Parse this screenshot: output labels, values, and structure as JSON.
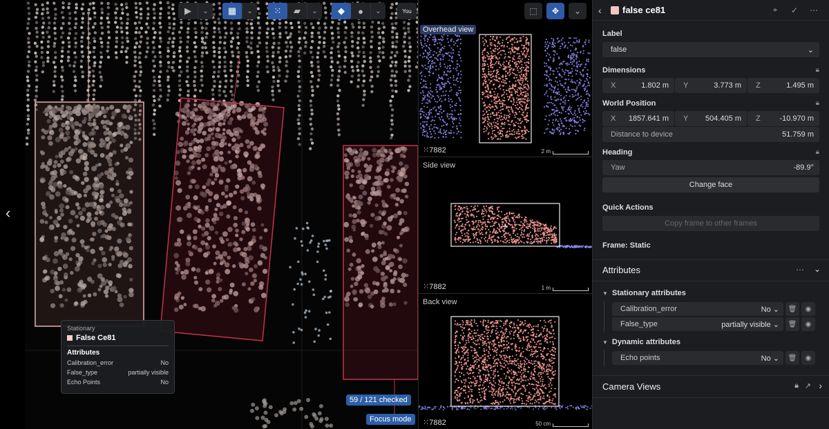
{
  "toolbar": {
    "icons": [
      "camera-icon",
      "grid-icon",
      "points-icon",
      "label-icon",
      "layers-icon",
      "sphere-icon"
    ],
    "you_badge": "You"
  },
  "hover_card": {
    "category": "Stationary",
    "name": "False Ce81",
    "attributes_heading": "Attributes",
    "rows": [
      {
        "k": "Calibration_error",
        "v": "No"
      },
      {
        "k": "False_type",
        "v": "partially visible"
      },
      {
        "k": "Echo Points",
        "v": "No"
      }
    ]
  },
  "status": {
    "checked": "59 / 121 checked",
    "focus_mode": "Focus mode"
  },
  "views": {
    "overhead": {
      "title": "Overhead view",
      "id": "7882",
      "scale": "2 m"
    },
    "side": {
      "title": "Side view",
      "id": "7882",
      "scale": "1 m"
    },
    "back": {
      "title": "Back view",
      "id": "7882",
      "scale": "50 cm"
    }
  },
  "panel": {
    "header_title": "false ce81",
    "label": {
      "title": "Label",
      "value": "false"
    },
    "dimensions": {
      "title": "Dimensions",
      "x": {
        "k": "X",
        "v": "1.802 m"
      },
      "y": {
        "k": "Y",
        "v": "3.773 m"
      },
      "z": {
        "k": "Z",
        "v": "1.495 m"
      }
    },
    "world_position": {
      "title": "World Position",
      "x": {
        "k": "X",
        "v": "1857.641 m"
      },
      "y": {
        "k": "Y",
        "v": "504.405 m"
      },
      "z": {
        "k": "Z",
        "v": "-10.970 m"
      },
      "distance": {
        "k": "Distance to device",
        "v": "51.759 m"
      }
    },
    "heading": {
      "title": "Heading",
      "yaw": {
        "k": "Yaw",
        "v": "-89.9°"
      },
      "change_face": "Change face"
    },
    "quick_actions": {
      "title": "Quick Actions",
      "copy_frame": "Copy frame to other frames"
    },
    "frame": "Frame: Static",
    "attributes": {
      "title": "Attributes",
      "stationary_title": "Stationary attributes",
      "stationary": [
        {
          "k": "Calibration_error",
          "v": "No"
        },
        {
          "k": "False_type",
          "v": "partially visible"
        }
      ],
      "dynamic_title": "Dynamic attributes",
      "dynamic": [
        {
          "k": "Echo points",
          "v": "No"
        }
      ]
    },
    "camera_views": "Camera Views"
  },
  "colors": {
    "accent": "#2f5aa6",
    "object_swatch": "#f3c6c0",
    "selected_box": "#c0344c",
    "hover_box": "#e8b4ac",
    "ortho_points": "#f59a96",
    "other_points": "#8f8cf0"
  }
}
